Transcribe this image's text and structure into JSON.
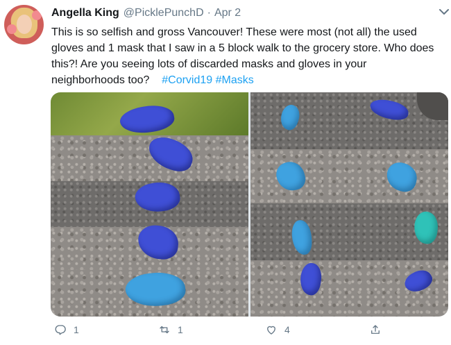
{
  "tweet": {
    "author_name": "Angella King",
    "handle": "@PicklePunchD",
    "separator": "·",
    "date": "Apr 2",
    "text_plain": "This is so selfish and gross Vancouver! These were most (not all) the used gloves and 1 mask that I saw in a 5 block walk to the grocery store. Who does this?!  Are you seeing lots of discarded masks and gloves in your neighborhoods too?",
    "hashtags": [
      "#Corvid19",
      "#Masks"
    ]
  },
  "actions": {
    "reply_count": "1",
    "retweet_count": "1",
    "like_count": "4"
  },
  "icons": {
    "more": "chevron-down-icon",
    "reply": "reply-icon",
    "retweet": "retweet-icon",
    "like": "heart-icon",
    "share": "share-icon"
  },
  "colors": {
    "accent": "#1da1f2",
    "muted": "#657786",
    "text": "#14171a"
  }
}
